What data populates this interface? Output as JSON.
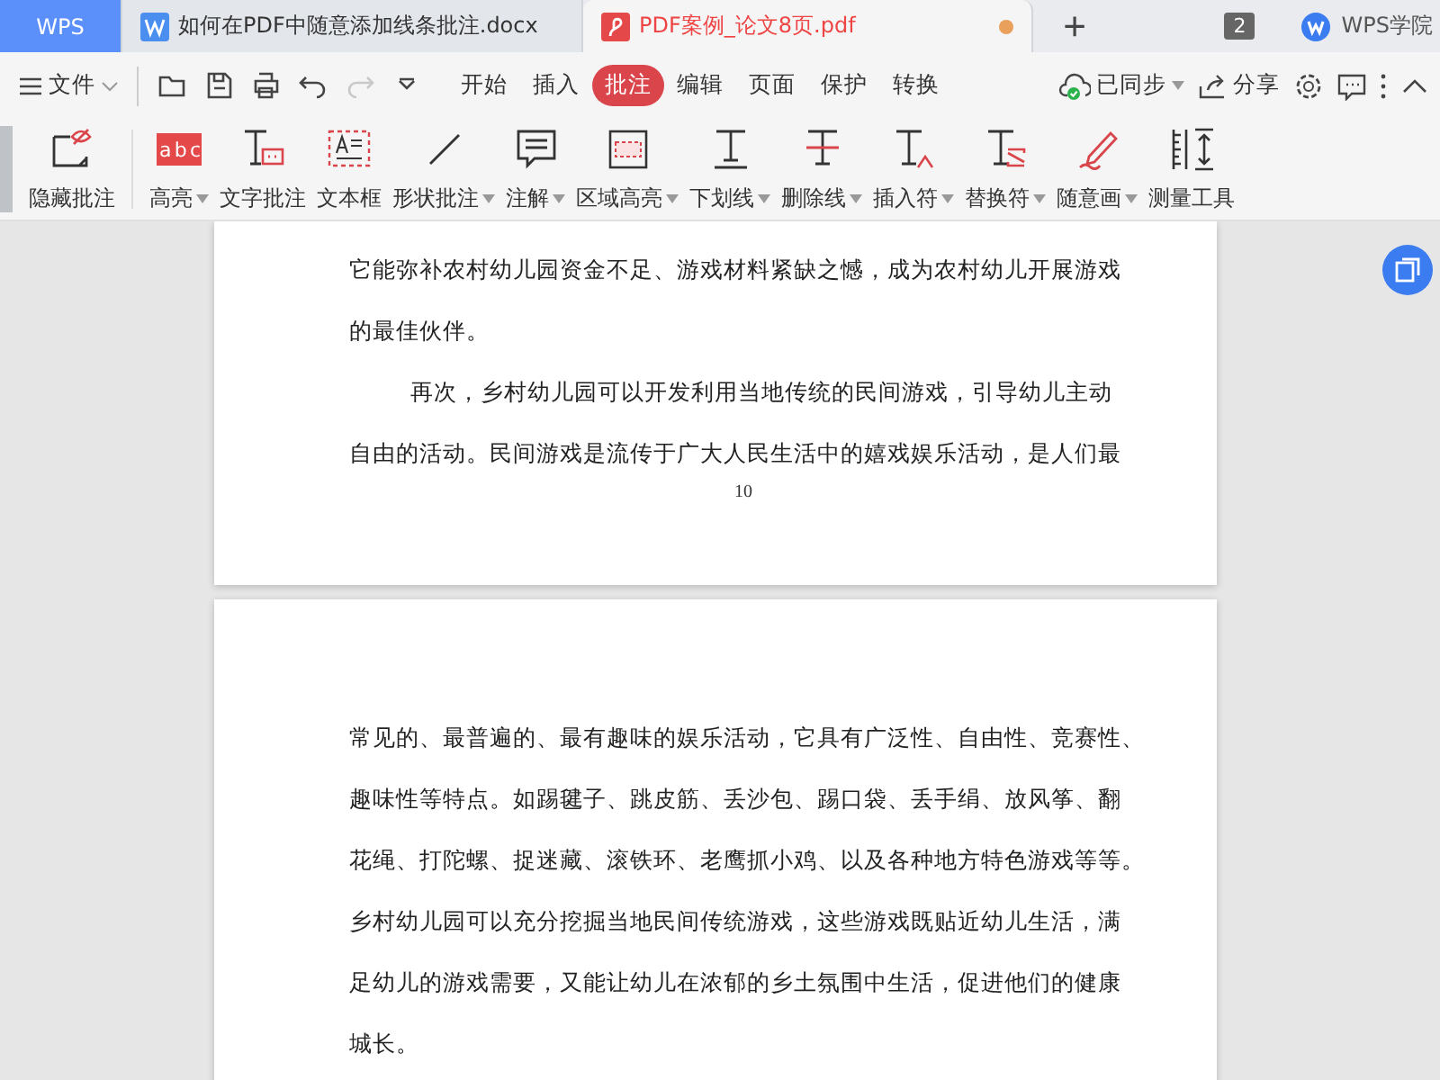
{
  "tabs": [
    {
      "label": "WPS",
      "kind": "home",
      "selected": false,
      "unsaved": false
    },
    {
      "label": "如何在PDF中随意添加线条批注.docx",
      "kind": "doc",
      "selected": false,
      "unsaved": false
    },
    {
      "label": "PDF案例_论文8页.pdf",
      "kind": "pdf",
      "selected": true,
      "unsaved": true
    }
  ],
  "new_tab": "+",
  "window_count": "2",
  "academy": {
    "label": "WPS学院"
  },
  "menu": {
    "file": "文件",
    "quick_actions": [
      {
        "kind": "open",
        "disabled": false
      },
      {
        "kind": "save",
        "disabled": false
      },
      {
        "kind": "print",
        "disabled": false
      },
      {
        "kind": "undo",
        "disabled": false
      },
      {
        "kind": "redo",
        "disabled": true
      },
      {
        "kind": "more",
        "disabled": false
      }
    ],
    "tabs": [
      {
        "label": "开始",
        "selected": false
      },
      {
        "label": "插入",
        "selected": false
      },
      {
        "label": "批注",
        "selected": true
      },
      {
        "label": "编辑",
        "selected": false
      },
      {
        "label": "页面",
        "selected": false
      },
      {
        "label": "保护",
        "selected": false
      },
      {
        "label": "转换",
        "selected": false
      }
    ],
    "sync": "已同步",
    "share": "分享"
  },
  "toolbar": [
    {
      "label": "隐藏批注",
      "has_menu": false
    },
    {
      "label": "高亮",
      "has_menu": true,
      "icon_text": "abc"
    },
    {
      "label": "文字批注",
      "has_menu": false
    },
    {
      "label": "文本框",
      "has_menu": false
    },
    {
      "label": "形状批注",
      "has_menu": true
    },
    {
      "label": "注解",
      "has_menu": true
    },
    {
      "label": "区域高亮",
      "has_menu": true
    },
    {
      "label": "下划线",
      "has_menu": true
    },
    {
      "label": "删除线",
      "has_menu": true
    },
    {
      "label": "插入符",
      "has_menu": true
    },
    {
      "label": "替换符",
      "has_menu": true
    },
    {
      "label": "随意画",
      "has_menu": true
    },
    {
      "label": "测量工具",
      "has_menu": false
    }
  ],
  "pages": [
    {
      "lines": [
        {
          "text": "它能弥补农村幼儿园资金不足、游戏材料紧缺之憾，成为农村幼儿开展游戏",
          "indent": false
        },
        {
          "text": "的最佳伙伴。",
          "indent": false
        },
        {
          "text": "再次，乡村幼儿园可以开发利用当地传统的民间游戏，引导幼儿主动",
          "indent": true
        },
        {
          "text": "自由的活动。民间游戏是流传于广大人民生活中的嬉戏娱乐活动，是人们最",
          "indent": false
        }
      ],
      "page_number": "10"
    },
    {
      "lines": [
        {
          "text": "常见的、最普遍的、最有趣味的娱乐活动，它具有广泛性、自由性、竞赛性、",
          "indent": false
        },
        {
          "text": "趣味性等特点。如踢毽子、跳皮筋、丢沙包、踢口袋、丢手绢、放风筝、翻",
          "indent": false
        },
        {
          "text": "花绳、打陀螺、捉迷藏、滚铁环、老鹰抓小鸡、以及各种地方特色游戏等等。",
          "indent": false
        },
        {
          "text": "乡村幼儿园可以充分挖掘当地民间传统游戏，这些游戏既贴近幼儿生活，满",
          "indent": false
        },
        {
          "text": "足幼儿的游戏需要，又能让幼儿在浓郁的乡土氛围中生活，促进他们的健康",
          "indent": false
        },
        {
          "text": "城长。",
          "indent": false
        }
      ]
    }
  ]
}
